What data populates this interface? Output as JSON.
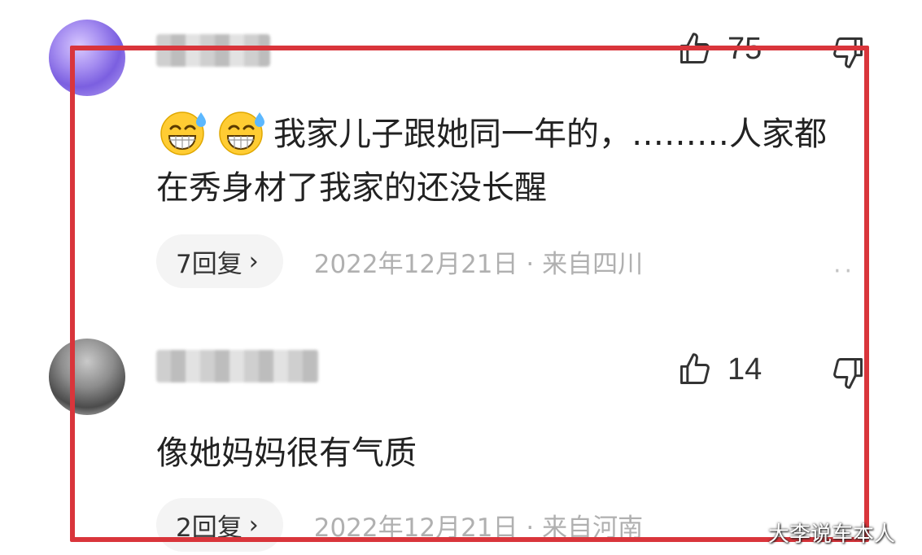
{
  "comments": [
    {
      "likes": "75",
      "emoji": [
        "grinning-sweat-emoji",
        "grinning-sweat-emoji"
      ],
      "text": "我家儿子跟她同一年的，………人家都在秀身材了我家的还没长醒",
      "reply_label": "7回复",
      "date_location": "2022年12月21日 · 来自四川",
      "more": "··"
    },
    {
      "likes": "14",
      "text": "像她妈妈很有气质",
      "reply_label": "2回复",
      "date_location": "2022年12月21日 · 来自河南"
    }
  ],
  "icons": {
    "reply_chevron": "›",
    "like": "thumbs-up-icon",
    "dislike": "thumbs-down-icon"
  },
  "watermark": "大李说车本人",
  "colors": {
    "frame": "#d9353b",
    "meta_text": "#b0b0b0",
    "reply_bg": "#f4f4f4"
  }
}
